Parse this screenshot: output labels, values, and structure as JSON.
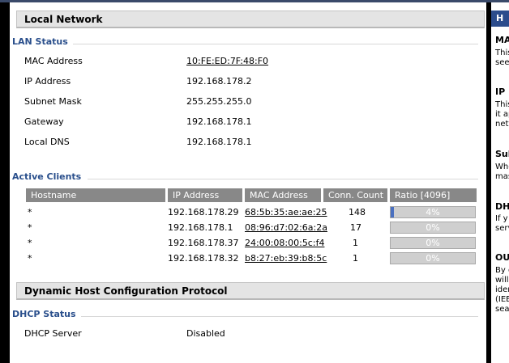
{
  "local_network": {
    "title": "Local Network",
    "lan_status": {
      "legend": "LAN Status",
      "rows": [
        {
          "label": "MAC Address",
          "value": "10:FE:ED:7F:48:F0"
        },
        {
          "label": "IP Address",
          "value": "192.168.178.2"
        },
        {
          "label": "Subnet Mask",
          "value": "255.255.255.0"
        },
        {
          "label": "Gateway",
          "value": "192.168.178.1"
        },
        {
          "label": "Local DNS",
          "value": "192.168.178.1"
        }
      ]
    },
    "active_clients": {
      "legend": "Active Clients",
      "headers": [
        "Hostname",
        "IP Address",
        "MAC Address",
        "Conn. Count",
        "Ratio [4096]"
      ],
      "rows": [
        {
          "hostname": "*",
          "ip": "192.168.178.29",
          "mac": "68:5b:35:ae:ae:25",
          "count": "148",
          "ratio": 0.04,
          "ratio_label": "4%"
        },
        {
          "hostname": "*",
          "ip": "192.168.178.1",
          "mac": "08:96:d7:02:6a:2a",
          "count": "17",
          "ratio": 0,
          "ratio_label": "0%"
        },
        {
          "hostname": "*",
          "ip": "192.168.178.37",
          "mac": "24:00:08:00:5c:f4",
          "count": "1",
          "ratio": 0,
          "ratio_label": "0%"
        },
        {
          "hostname": "*",
          "ip": "192.168.178.32",
          "mac": "b8:27:eb:39:b8:5c",
          "count": "1",
          "ratio": 0,
          "ratio_label": "0%"
        }
      ]
    }
  },
  "dhcp": {
    "title": "Dynamic Host Configuration Protocol",
    "status_legend": "DHCP Status",
    "server_label": "DHCP Server",
    "server_value": "Disabled"
  },
  "help": {
    "title": "H",
    "sections": [
      {
        "heading": "MA",
        "lines": [
          "This",
          "see"
        ]
      },
      {
        "heading": "IP .",
        "lines": [
          "This",
          "it ap",
          "netv"
        ]
      },
      {
        "heading": "Sub",
        "lines": [
          "Whe",
          "mas"
        ]
      },
      {
        "heading": "DH",
        "lines": [
          "If y",
          "serv"
        ]
      },
      {
        "heading": "OU",
        "lines": [
          "By d",
          "will",
          "iden",
          "(IEE",
          "sea"
        ]
      }
    ]
  },
  "colors": {
    "accent": "#2a4f8c",
    "bar_fill": "#4a70c0",
    "header_bg": "#888888"
  }
}
